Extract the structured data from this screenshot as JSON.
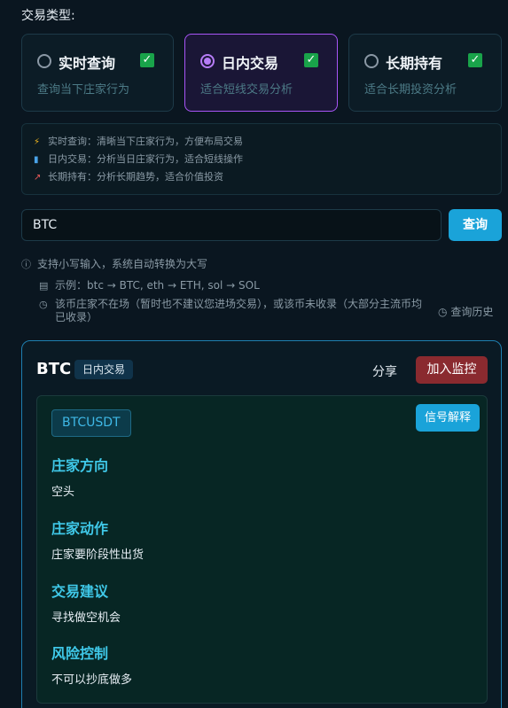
{
  "trade_type": {
    "label": "交易类型:",
    "options": [
      {
        "name": "实时查询",
        "desc": "查询当下庄家行为",
        "selected": false
      },
      {
        "name": "日内交易",
        "desc": "适合短线交易分析",
        "selected": true
      },
      {
        "name": "长期持有",
        "desc": "适合长期投资分析",
        "selected": false
      }
    ],
    "check_glyph": "✓"
  },
  "info": {
    "lines": [
      {
        "icon": "⚡",
        "icon_name": "lightning-icon",
        "text": "实时查询：清晰当下庄家行为，方便布局交易"
      },
      {
        "icon": "▮",
        "icon_name": "bar-chart-icon",
        "text": "日内交易：分析当日庄家行为，适合短线操作"
      },
      {
        "icon": "↗",
        "icon_name": "trend-chart-icon",
        "text": "长期持有：分析长期趋势，适合价值投资"
      }
    ]
  },
  "search": {
    "value": "BTC",
    "button_label": "查询"
  },
  "hints": {
    "case_hint": "支持小写输入，系统自动转换为大写",
    "examples": "示例：btc → BTC, eth → ETH, sol → SOL",
    "warning_line1": "该币庄家不在场（暂时也不建议您进场交易），或该币未收录（大部分主流币均",
    "warning_line2": "已收录）",
    "history_label": "查询历史"
  },
  "result": {
    "symbol": "BTC",
    "mode": "日内交易",
    "share_label": "分享",
    "monitor_label": "加入监控",
    "pair": "BTCUSDT",
    "explain_label": "信号解释",
    "signals": [
      {
        "title": "庄家方向",
        "value": "空头"
      },
      {
        "title": "庄家动作",
        "value": "庄家要阶段性出货"
      },
      {
        "title": "交易建议",
        "value": "寻找做空机会"
      },
      {
        "title": "风险控制",
        "value": "不可以抄底做多"
      }
    ]
  },
  "colors": {
    "accent_purple": "#a855f7",
    "accent_blue": "#1aa3d9",
    "check_green": "#19a34a",
    "monitor_red": "#8a2a2f",
    "signal_title": "#3fc8e8"
  }
}
